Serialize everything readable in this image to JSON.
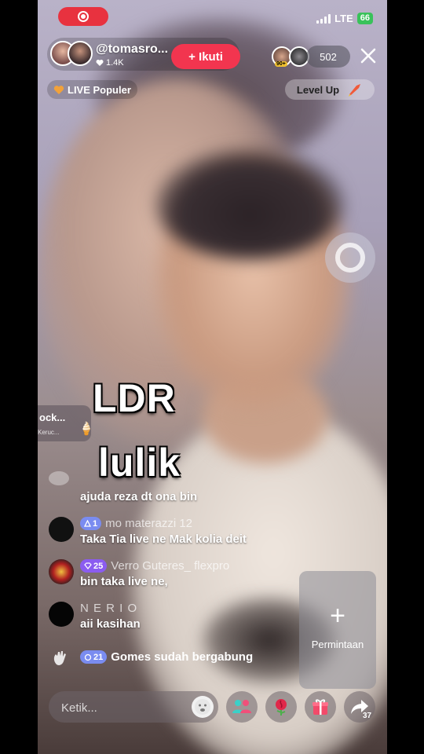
{
  "status_bar": {
    "network": "LTE",
    "battery": "66"
  },
  "host": {
    "name": "@tomasro...",
    "likes": "1.4K",
    "follow_label": "+ Ikuti"
  },
  "viewers": {
    "badge": "90+",
    "count": "502"
  },
  "badges": {
    "live_popular": "LIVE Populer",
    "level_up": "Level Up"
  },
  "side_card": {
    "title": "ock...",
    "subtitle": "Keruc..."
  },
  "caption": {
    "line1": "LDR",
    "line2": "lulik"
  },
  "chat": {
    "messages": [
      {
        "user": "",
        "level": "",
        "text": "ajuda reza dt ona bin"
      },
      {
        "user": "mo materazzi 12",
        "level": "1",
        "text": "Taka Tia live ne Mak kolia deit"
      },
      {
        "user": "Verro Guteres_ flexpro",
        "level": "25",
        "text": "bin taka live ne,"
      },
      {
        "user": "N E R I O",
        "level": "",
        "text": "aii kasihan"
      }
    ],
    "join": {
      "level": "21",
      "text": "Gomes sudah bergabung"
    }
  },
  "request_button": {
    "label": "Permintaan"
  },
  "bottom_bar": {
    "comment_placeholder": "Ketik...",
    "share_count": "37"
  },
  "colors": {
    "follow_red": "#f2354f",
    "record_red": "#e8323f",
    "level_blue": "#7a8cf0",
    "level_purple": "#8b5cf0",
    "battery_green": "#39c25a"
  },
  "icons": [
    "record-icon",
    "signal-icon",
    "heart-icon",
    "close-icon",
    "fire-heart-icon",
    "rocket-icon",
    "emoji-icon",
    "guests-icon",
    "rose-icon",
    "gift-icon",
    "share-icon",
    "wave-icon",
    "plus-icon"
  ]
}
